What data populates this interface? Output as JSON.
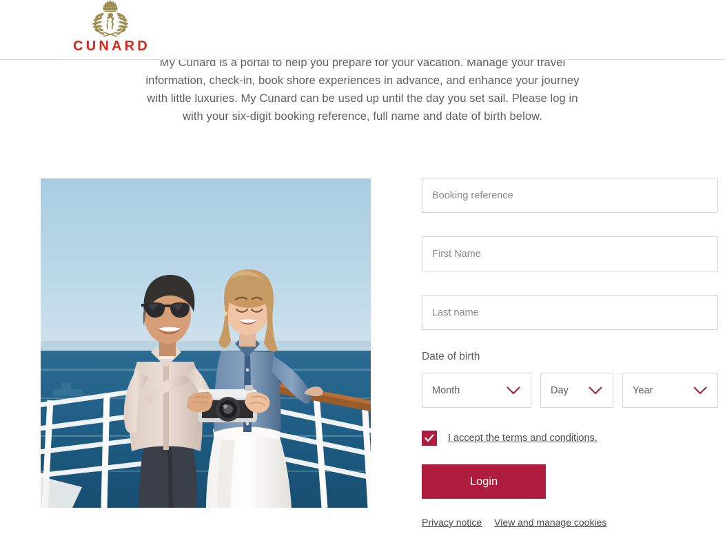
{
  "header": {
    "logo_wordmark": "CUNARD",
    "logo_crest_name": "cunard-lion-crest",
    "brand_red": "#d9261c",
    "crest_gold": "#a08f50"
  },
  "intro": {
    "paragraph": "My Cunard is a portal to help you prepare for your vacation. Manage your travel information, check-in, book shore experiences in advance, and enhance your journey with little luxuries. My Cunard can be used up until the day you set sail. Please log in with your six-digit booking reference, full name and date of birth below."
  },
  "photo": {
    "alt": "Smiling couple looking at a camera on a cruise ship deck with ocean behind"
  },
  "form": {
    "booking_reference": {
      "placeholder": "Booking reference",
      "value": ""
    },
    "first_name": {
      "placeholder": "First Name",
      "value": ""
    },
    "last_name": {
      "placeholder": "Last name",
      "value": ""
    },
    "dob_label": "Date of birth",
    "dob": {
      "month": {
        "selected": "Month"
      },
      "day": {
        "selected": "Day"
      },
      "year": {
        "selected": "Year"
      }
    },
    "terms": {
      "label": "I accept the terms and conditions.",
      "checked": true
    },
    "login_label": "Login",
    "accent_color": "#b01c3d"
  },
  "footer": {
    "links": [
      {
        "label": "Privacy notice"
      },
      {
        "label": "View and manage cookies"
      }
    ]
  }
}
